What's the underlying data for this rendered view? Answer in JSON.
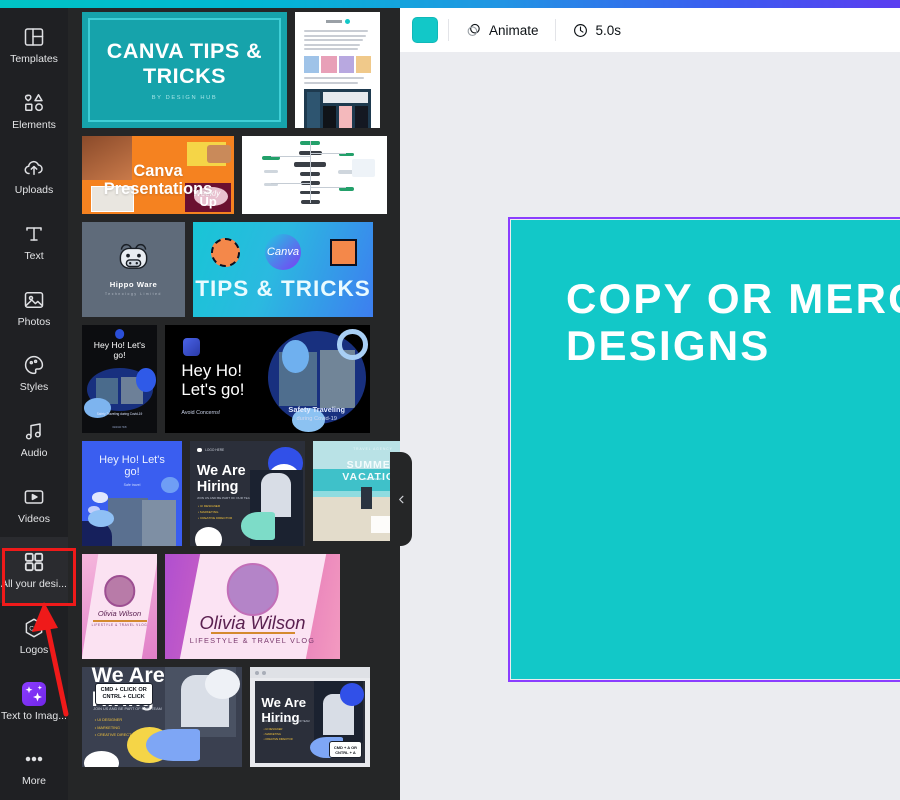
{
  "rail": {
    "items": [
      {
        "label": "Templates",
        "icon": "templates-icon",
        "selected": false
      },
      {
        "label": "Elements",
        "icon": "elements-icon",
        "selected": false
      },
      {
        "label": "Uploads",
        "icon": "uploads-icon",
        "selected": false
      },
      {
        "label": "Text",
        "icon": "text-icon",
        "selected": false
      },
      {
        "label": "Photos",
        "icon": "photos-icon",
        "selected": false
      },
      {
        "label": "Styles",
        "icon": "styles-icon",
        "selected": false
      },
      {
        "label": "Audio",
        "icon": "audio-icon",
        "selected": false
      },
      {
        "label": "Videos",
        "icon": "videos-icon",
        "selected": false
      },
      {
        "label": "All your desi...",
        "icon": "grid-icon",
        "selected": true
      },
      {
        "label": "Logos",
        "icon": "logos-icon",
        "selected": false
      },
      {
        "label": "Text to Imag...",
        "icon": "text-to-image-icon",
        "selected": false
      },
      {
        "label": "More",
        "icon": "more-icon",
        "selected": false
      }
    ]
  },
  "toolbar": {
    "color_swatch": "#12c8c8",
    "animate_label": "Animate",
    "duration_label": "5.0s"
  },
  "canvas": {
    "page_text": "COPY OR MERGE\nDESIGNS",
    "background": "#12c8c8",
    "selection_color": "#8b3dff",
    "text_color": "#ffffff"
  },
  "annotation": {
    "highlight_color": "#ef1a1a",
    "target": "All your desi..."
  },
  "panel": {
    "collapse_icon": "chevron-left-icon",
    "rows": [
      {
        "thumbs": [
          {
            "name": "canva-tips-tricks-teal",
            "title": "CANVA TIPS &\nTRICKS",
            "subtitle": "BY DESIGN HUB",
            "bg": "#16a3ab",
            "kind": "title"
          },
          {
            "name": "white-document",
            "title": "",
            "subtitle": "",
            "bg": "#ffffff",
            "kind": "doc"
          }
        ]
      },
      {
        "thumbs": [
          {
            "name": "canva-presentations-orange",
            "title": "Canva\nPresentations",
            "subtitle": "Weekly Up",
            "bg": "#f58220",
            "kind": "orange"
          },
          {
            "name": "mind-map-white",
            "title": "",
            "subtitle": "",
            "bg": "#ffffff",
            "kind": "mindmap"
          }
        ]
      },
      {
        "thumbs": [
          {
            "name": "hippo-ware-logo",
            "title": "Hippo Ware",
            "subtitle": "Technology  Limited",
            "bg": "#5f6b7a",
            "kind": "hippo"
          },
          {
            "name": "tips-and-tricks-gradient",
            "title": "TIPS & TRICKS",
            "subtitle": "Canva",
            "bg": "#1fb6d6",
            "kind": "gradient"
          }
        ]
      },
      {
        "thumbs": [
          {
            "name": "hey-ho-lets-go-story",
            "title": "Hey Ho! Let's\ngo!",
            "subtitle": "Safety Traveling during Covid-19",
            "bg": "#0c0d10",
            "kind": "heyho-story"
          },
          {
            "name": "hey-ho-lets-go-wide",
            "title": "Hey Ho!\nLet's go!",
            "subtitle": "Safety Traveling during Covid-19",
            "bg": "#000000",
            "kind": "heyho-wide"
          }
        ]
      },
      {
        "thumbs": [
          {
            "name": "hey-ho-blue-post",
            "title": "Hey Ho! Let's\ngo!",
            "subtitle": "",
            "bg": "#3a5ef0",
            "kind": "heyho-blue"
          },
          {
            "name": "we-are-hiring-dark",
            "title": "We Are\nHiring",
            "subtitle": "",
            "bg": "#2b2f3a",
            "kind": "hiring"
          },
          {
            "name": "summer-vacation-beach",
            "title": "SUMMER\nVACATION",
            "subtitle": "",
            "bg": "#8fd3d8",
            "kind": "beach"
          }
        ]
      },
      {
        "thumbs": [
          {
            "name": "olivia-wilson-story",
            "title": "Olivia Wilson",
            "subtitle": "LIFESTYLE & TRAVEL VLOG",
            "bg": "#f0a8d8",
            "kind": "olivia-story"
          },
          {
            "name": "olivia-wilson-wide",
            "title": "Olivia Wilson",
            "subtitle": "LIFESTYLE & TRAVEL VLOG",
            "bg": "#d36cd0",
            "kind": "olivia-wide"
          }
        ]
      },
      {
        "thumbs": [
          {
            "name": "we-are-hiring-cmd-click",
            "title": "We Are\nHiring",
            "subtitle": "CMD + CLICK OR\nCNTRL + CLICK",
            "bg": "#3a4050",
            "kind": "hiring-callout"
          },
          {
            "name": "we-are-hiring-cmd-a",
            "title": "We Are\nHiring",
            "subtitle": "CMD + A OR\nCNTRL + A",
            "bg": "#e9eaee",
            "kind": "hiring-screen"
          }
        ]
      }
    ]
  }
}
